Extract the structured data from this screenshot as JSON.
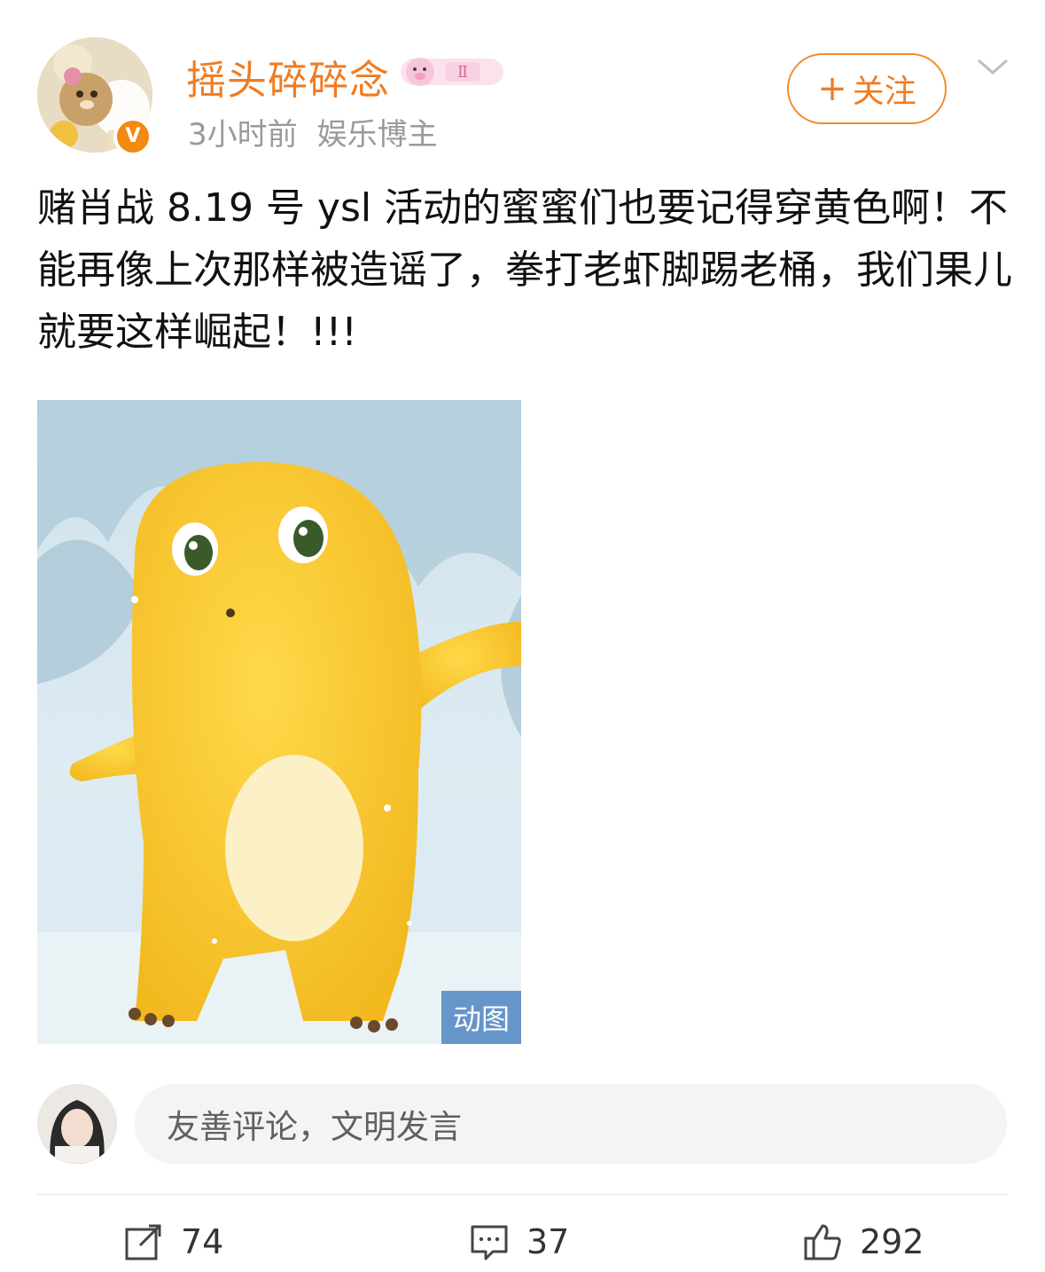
{
  "header": {
    "username": "摇头碎碎念",
    "badge_text": "Ⅱ",
    "verified_mark": "V",
    "time": "3小时前",
    "tag": "娱乐博主",
    "follow_label": "关注",
    "follow_plus": "+"
  },
  "post": {
    "text": "赌肖战 8.19 号 ysl 活动的蜜蜜们也要记得穿黄色啊！不能再像上次那样被造谣了，拳打老虾脚踢老桶，我们果儿就要这样崛起！!!!",
    "media_tag": "动图"
  },
  "comment_box": {
    "placeholder": "友善评论，文明发言"
  },
  "actions": {
    "repost_count": "74",
    "comment_count": "37",
    "like_count": "292"
  },
  "icons": {
    "repost": "share-icon",
    "comment": "comment-icon",
    "like": "thumbs-up-icon",
    "more": "chevron-down-icon"
  },
  "colors": {
    "accent": "#f07c22",
    "verified": "#f28a12",
    "gif_tag_bg": "#5b8ec6"
  }
}
